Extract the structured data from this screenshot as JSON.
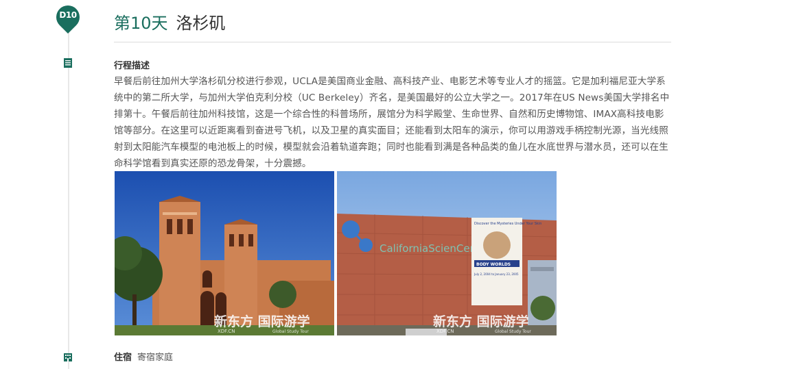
{
  "day": {
    "badge": "D10",
    "number_label": "第10天",
    "city": "洛杉矶"
  },
  "description": {
    "label": "行程描述",
    "text": "早餐后前往加州大学洛杉矶分校进行参观，UCLA是美国商业金融、高科技产业、电影艺术等专业人才的摇篮。它是加利福尼亚大学系统中的第二所大学，与加州大学伯克利分校（UC Berkeley）齐名，是美国最好的公立大学之一。2017年在US News美国大学排名中排第十。午餐后前往加州科技馆，这是一个综合性的科普场所，展馆分为科学殿堂、生命世界、自然和历史博物馆、IMAX高科技电影馆等部分。在这里可以近距离看到奋进号飞机，以及卫星的真实面目；还能看到太阳车的演示，你可以用游戏手柄控制光源，当光线照射到太阳能汽车模型的电池板上的时候，模型就会沿着轨道奔跑；同时也能看到满是各种品类的鱼儿在水底世界与潜水员，还可以在生命科学馆看到真实还原的恐龙骨架，十分震撼。"
  },
  "photos": [
    {
      "watermark": "新东方 国际游学",
      "watermark_sub": "XDF.CN",
      "watermark_en": "Global Study Tour"
    },
    {
      "sign": "CaliforniaScienCenter",
      "poster_title": "Discover the Mysteries Under Your Skin",
      "poster_banner": "BODY WORLDS",
      "poster_dates": "July 2, 2004 to January 23, 2005",
      "watermark": "新东方 国际游学",
      "watermark_sub": "XDF.CN",
      "watermark_en": "Global Study Tour"
    }
  ],
  "stay": {
    "label": "住宿",
    "value": "寄宿家庭"
  },
  "colors": {
    "accent": "#1a6e5e",
    "divider": "#dcdcdc"
  },
  "icons": [
    "list-icon",
    "building-icon"
  ]
}
